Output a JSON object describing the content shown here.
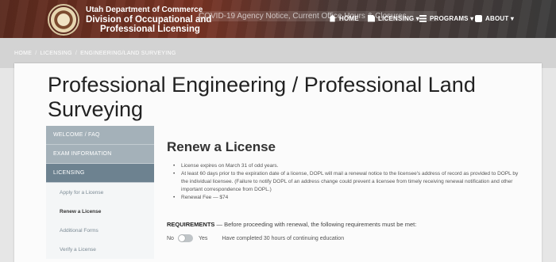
{
  "header": {
    "org_line1": "Utah Department of Commerce",
    "org_line2": "Division of Occupational and",
    "org_line3": "Professional Licensing",
    "alert_text": "COVID-19 Agency Notice, Current Office Hours & Closures",
    "nav": {
      "home": "HOME",
      "licensing": "LICENSING ▾",
      "programs": "PROGRAMS ▾",
      "about": "ABOUT ▾"
    }
  },
  "breadcrumb": {
    "items": [
      "HOME",
      "LICENSING",
      "ENGINEERING/LAND SURVEYING"
    ]
  },
  "page_title": "Professional Engineering / Professional Land Surveying",
  "sidebar": {
    "top_items": [
      "WELCOME / FAQ",
      "EXAM INFORMATION"
    ],
    "active_section": "LICENSING",
    "sub_items": [
      "Apply for a License",
      "Renew a License",
      "Additional Forms",
      "Verify a License"
    ]
  },
  "content": {
    "title": "Renew a License",
    "bullets": [
      "License expires on March 31 of odd years.",
      "At least 60 days prior to the expiration date of a license, DOPL will mail a renewal notice to the licensee's address of record as provided to DOPL by the individual licensee. (Failure to notify DOPL of an address change could prevent a licensee from timely receiving renewal notification and other important correspondence from DOPL.)",
      "Renewal Fee — $74"
    ],
    "requirements_label": "REQUIREMENTS",
    "requirements_text": "— Before proceeding with renewal, the following requirements must be met:",
    "toggle_no": "No",
    "toggle_yes": "Yes",
    "toggle_question": "Have completed 30 hours of continuing education"
  }
}
